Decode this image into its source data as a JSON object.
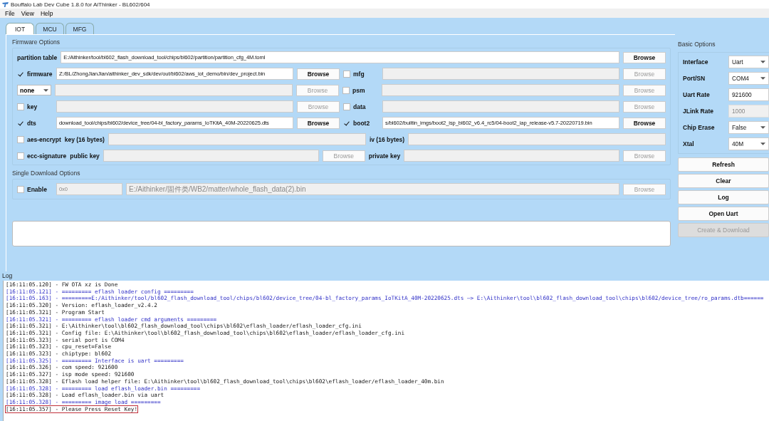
{
  "window": {
    "title": "Bouffalo Lab Dev Cube 1.8.0 for AiThinker - BL602/604"
  },
  "menu": [
    "File",
    "View",
    "Help"
  ],
  "tabs": [
    {
      "label": "IOT",
      "selected": true
    },
    {
      "label": "MCU",
      "selected": false
    },
    {
      "label": "MFG",
      "selected": false
    }
  ],
  "firmware_options": {
    "title": "Firmware Options",
    "partition_table": {
      "label": "partition table",
      "value": "E:/Aithinker/tool/bl602_flash_download_tool/chips/bl602/partition/partition_cfg_4M.toml",
      "browse": "Browse"
    },
    "rows": [
      [
        {
          "kind": "check",
          "label": "firmware",
          "checked": true
        },
        {
          "kind": "field",
          "value": "Z:/BL/ZhongJianJian/aithinker_dev_sdk/dev/out/bl602/aws_iot_demo/bin/dev_project.bin",
          "disabled": false
        },
        {
          "kind": "button",
          "label": "Browse",
          "disabled": false
        },
        {
          "kind": "check",
          "label": "mfg",
          "checked": false
        },
        {
          "kind": "field",
          "disabled": true
        },
        {
          "kind": "button",
          "label": "Browse",
          "disabled": true
        }
      ],
      [
        {
          "kind": "select",
          "value": "none"
        },
        {
          "kind": "field",
          "disabled": true
        },
        {
          "kind": "button",
          "label": "Browse",
          "disabled": true
        },
        {
          "kind": "check",
          "label": "psm",
          "checked": false
        },
        {
          "kind": "field",
          "disabled": true
        },
        {
          "kind": "button",
          "label": "Browse",
          "disabled": true
        }
      ],
      [
        {
          "kind": "check",
          "label": "key",
          "checked": false
        },
        {
          "kind": "field",
          "disabled": true
        },
        {
          "kind": "button",
          "label": "Browse",
          "disabled": true
        },
        {
          "kind": "check",
          "label": "data",
          "checked": false
        },
        {
          "kind": "field",
          "disabled": true
        },
        {
          "kind": "button",
          "label": "Browse",
          "disabled": true
        }
      ],
      [
        {
          "kind": "check",
          "label": "dts",
          "checked": true
        },
        {
          "kind": "field",
          "value": "download_tool/chips/bl602/device_tree/04-bl_factory_params_IoTKitA_40M-20220625.dts",
          "disabled": false
        },
        {
          "kind": "button",
          "label": "Browse",
          "disabled": false
        },
        {
          "kind": "check",
          "label": "boot2",
          "checked": true
        },
        {
          "kind": "field",
          "value": "s/bl602/builtin_imgs/boot2_isp_bl602_v6.4_rc5/04-boot2_iap_release-v5.7-20220719.bin",
          "disabled": false
        },
        {
          "kind": "button",
          "label": "Browse",
          "disabled": false
        }
      ],
      [
        {
          "kind": "check",
          "label": "aes-encrypt",
          "checked": false
        },
        {
          "kind": "label",
          "text": "key (16 bytes)"
        },
        {
          "kind": "field",
          "disabled": true
        },
        {
          "kind": "label",
          "text": "iv (16 bytes)"
        },
        {
          "kind": "field",
          "disabled": true
        }
      ],
      [
        {
          "kind": "check",
          "label": "ecc-signature",
          "checked": false
        },
        {
          "kind": "label",
          "text": "public key"
        },
        {
          "kind": "field",
          "disabled": true
        },
        {
          "kind": "button",
          "label": "Browse",
          "disabled": true
        },
        {
          "kind": "label",
          "text": "private key"
        },
        {
          "kind": "field",
          "disabled": true
        },
        {
          "kind": "button",
          "label": "Browse",
          "disabled": true
        }
      ]
    ]
  },
  "single_download": {
    "title": "Single Download Options",
    "enable": {
      "label": "Enable",
      "checked": false
    },
    "address": "0x0",
    "file": "E:/Aithinker/固件类/WB2/matter/whole_flash_data(2).bin",
    "browse": {
      "label": "Browse",
      "disabled": true
    }
  },
  "basic_options": {
    "title": "Basic Options",
    "rows": [
      {
        "label": "Interface",
        "kind": "select",
        "value": "Uart"
      },
      {
        "label": "Port/SN",
        "kind": "select",
        "value": "COM4"
      },
      {
        "label": "Uart Rate",
        "kind": "input",
        "value": "921600",
        "disabled": false
      },
      {
        "label": "JLink Rate",
        "kind": "input",
        "value": "1000",
        "disabled": true
      },
      {
        "label": "Chip Erase",
        "kind": "select",
        "value": "False"
      },
      {
        "label": "Xtal",
        "kind": "select",
        "value": "40M"
      }
    ]
  },
  "buttons": [
    {
      "label": "Refresh",
      "disabled": false
    },
    {
      "label": "Clear",
      "disabled": false
    },
    {
      "label": "Log",
      "disabled": false
    },
    {
      "label": "Open Uart",
      "disabled": false
    },
    {
      "label": "Create & Download",
      "disabled": true
    }
  ],
  "log": {
    "title": "Log",
    "lines": [
      {
        "text": "[16:11:05.120] - FW OTA xz is Done",
        "kind": "plain",
        "boxed": false
      },
      {
        "text": "[16:11:05.121] - ========= eflash loader config =========",
        "kind": "header",
        "boxed": false
      },
      {
        "text": "[16:11:05.163] - =========E:/Aithinker/tool/bl602_flash_download_tool/chips/bl602/device_tree/04-bl_factory_params_IoTKitA_40M-20220625.dts —> E:\\Aithinker\\tool\\bl602_flash_download_tool\\chips\\bl602/device_tree/ro_params.dtb======",
        "kind": "header",
        "boxed": false
      },
      {
        "text": "[16:11:05.320] - Version: eflash_loader_v2.4.2",
        "kind": "plain",
        "boxed": false
      },
      {
        "text": "[16:11:05.321] - Program Start",
        "kind": "plain",
        "boxed": false
      },
      {
        "text": "[16:11:05.321] - ========= eflash loader cmd arguments =========",
        "kind": "header",
        "boxed": false
      },
      {
        "text": "[16:11:05.321] - E:\\Aithinker\\tool\\bl602_flash_download_tool\\chips\\bl602\\eflash_loader/eflash_loader_cfg.ini",
        "kind": "plain",
        "boxed": false
      },
      {
        "text": "[16:11:05.321] - Config file: E:\\Aithinker\\tool\\bl602_flash_download_tool\\chips\\bl602\\eflash_loader/eflash_loader_cfg.ini",
        "kind": "plain",
        "boxed": false
      },
      {
        "text": "[16:11:05.323] - serial port is COM4",
        "kind": "plain",
        "boxed": false
      },
      {
        "text": "[16:11:05.323] - cpu_reset=False",
        "kind": "plain",
        "boxed": false
      },
      {
        "text": "[16:11:05.323] - chiptype: bl602",
        "kind": "plain",
        "boxed": false
      },
      {
        "text": "[16:11:05.325] - ========= Interface is uart =========",
        "kind": "header",
        "boxed": false
      },
      {
        "text": "[16:11:05.326] - com speed: 921600",
        "kind": "plain",
        "boxed": false
      },
      {
        "text": "[16:11:05.327] - isp mode speed: 921600",
        "kind": "plain",
        "boxed": false
      },
      {
        "text": "[16:11:05.328] - Eflash load helper file: E:\\Aithinker\\tool\\bl602_flash_download_tool\\chips\\bl602\\eflash_loader/eflash_loader_40m.bin",
        "kind": "plain",
        "boxed": false
      },
      {
        "text": "[16:11:05.328] - ========= load eflash_loader.bin =========",
        "kind": "header",
        "boxed": false
      },
      {
        "text": "[16:11:05.328] - Load eflash_loader.bin via uart",
        "kind": "plain",
        "boxed": false
      },
      {
        "text": "[16:11:05.328] - ========= image load =========",
        "kind": "header",
        "boxed": false
      },
      {
        "text": "[16:11:05.357] - Please Press Reset Key!",
        "kind": "plain",
        "boxed": true
      }
    ]
  }
}
